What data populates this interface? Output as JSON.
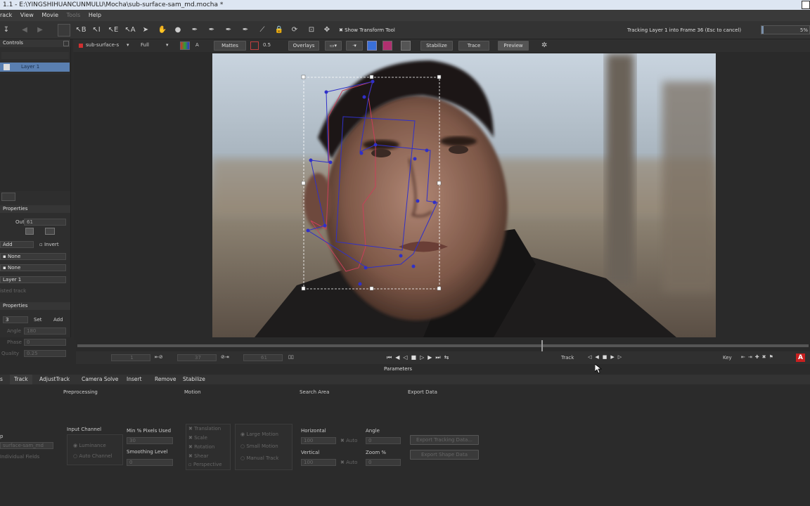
{
  "window": {
    "title": "1.1 - E:\\YINGSHIHUANCUNMULU\\Mocha\\sub-surface-sam_md.mocha *"
  },
  "menu": [
    "rack",
    "View",
    "Movie",
    "Tools",
    "Help"
  ],
  "toolbar": {
    "show_transform_tool": "Show Transform Tool",
    "status": "Tracking Layer 1 into Frame 36 (Esc to cancel)",
    "progress_label": "5%",
    "progress": 0.05
  },
  "toolbar2": {
    "clip": "sub-surface-s",
    "resolution": "Full",
    "mattes": "Mattes",
    "opacity": "0.5",
    "overlays": "Overlays",
    "stabilize": "Stabilize",
    "trace": "Trace",
    "preview": "Preview"
  },
  "sidebar": {
    "controls_title": "Controls",
    "layer_name": "Layer 1",
    "layer_properties_title": "Properties",
    "out_label": "Out",
    "out_value": "61",
    "blend_mode": "Add",
    "invert_label": "Invert",
    "matte1": "None",
    "matte2": "None",
    "link_layer": "Layer 1",
    "adjusted_track": "isted track",
    "edge_properties_title": "Properties",
    "edge_value": "3",
    "set_label": "Set",
    "add_label": "Add",
    "angle_label": "Angle",
    "angle_value": "180",
    "phase_label": "Phase",
    "phase_value": "0",
    "quality_label": "Quality",
    "quality_value": "0.25"
  },
  "transport": {
    "in_frame": "1",
    "current_frame": "37",
    "out_frame": "61",
    "track_label": "Track",
    "key_label": "Key"
  },
  "parameters_label": "Parameters",
  "tabs": [
    "s",
    "Track",
    "AdjustTrack",
    "Camera Solve",
    "Insert",
    "Remove",
    "Stabilize"
  ],
  "params": {
    "preprocessing": "Preprocessing",
    "motion": "Motion",
    "search_area": "Search Area",
    "export_data": "Export Data",
    "clip_label": "p",
    "clip_value": "surface-sam_md",
    "individual_fields": "Individual Fields",
    "input_channel": "Input Channel",
    "luminance": "Luminance",
    "auto_channel": "Auto Channel",
    "min_pixels": "Min % Pixels Used",
    "min_pixels_value": "30",
    "smoothing": "Smoothing Level",
    "smoothing_value": "0",
    "translation": "Translation",
    "scale": "Scale",
    "rotation": "Rotation",
    "shear": "Shear",
    "perspective": "Perspective",
    "large_motion": "Large Motion",
    "small_motion": "Small Motion",
    "manual_track": "Manual Track",
    "horizontal": "Horizontal",
    "horizontal_value": "100",
    "auto1": "Auto",
    "vertical": "Vertical",
    "vertical_value": "100",
    "auto2": "Auto",
    "angle": "Angle",
    "angle_value": "0",
    "zoom": "Zoom %",
    "zoom_value": "0",
    "export_tracking": "Export Tracking Data...",
    "export_shape": "Export Shape Data"
  },
  "colors": {
    "accent_blue": "#3a6fd8",
    "spline_red": "#c8405a",
    "spline_blue": "#3030c8",
    "layer_select": "#5a7fb0"
  }
}
